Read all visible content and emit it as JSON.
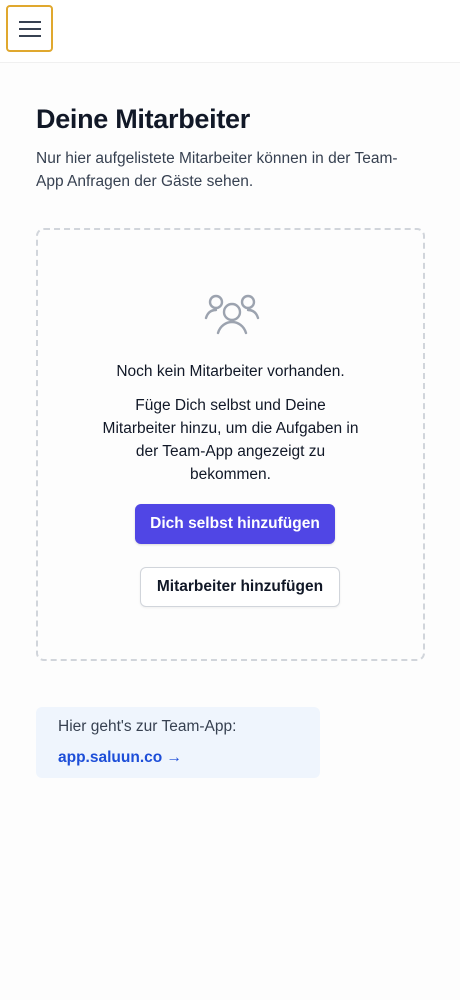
{
  "header": {
    "menu_icon": "hamburger-menu-icon",
    "accent_color": "#e0a82e"
  },
  "main": {
    "title": "Deine Mitarbeiter",
    "subtitle": "Nur hier aufgelistete Mitarbeiter können in der Team-App Anfragen der Gäste sehen."
  },
  "empty_state": {
    "icon": "users-group-icon",
    "title": "Noch kein Mitarbeiter vorhanden.",
    "description": "Füge Dich selbst und Deine Mitarbeiter hinzu, um die Aufgaben in der Team-App angezeigt zu bekommen.",
    "add_self_label": "Dich selbst hinzufügen",
    "add_employee_label": "Mitarbeiter hinzufügen",
    "primary_color": "#5046e5"
  },
  "team_app": {
    "label": "Hier geht's zur Team-App:",
    "link_text": "app.saluun.co →",
    "link_color": "#1d4ed8"
  }
}
